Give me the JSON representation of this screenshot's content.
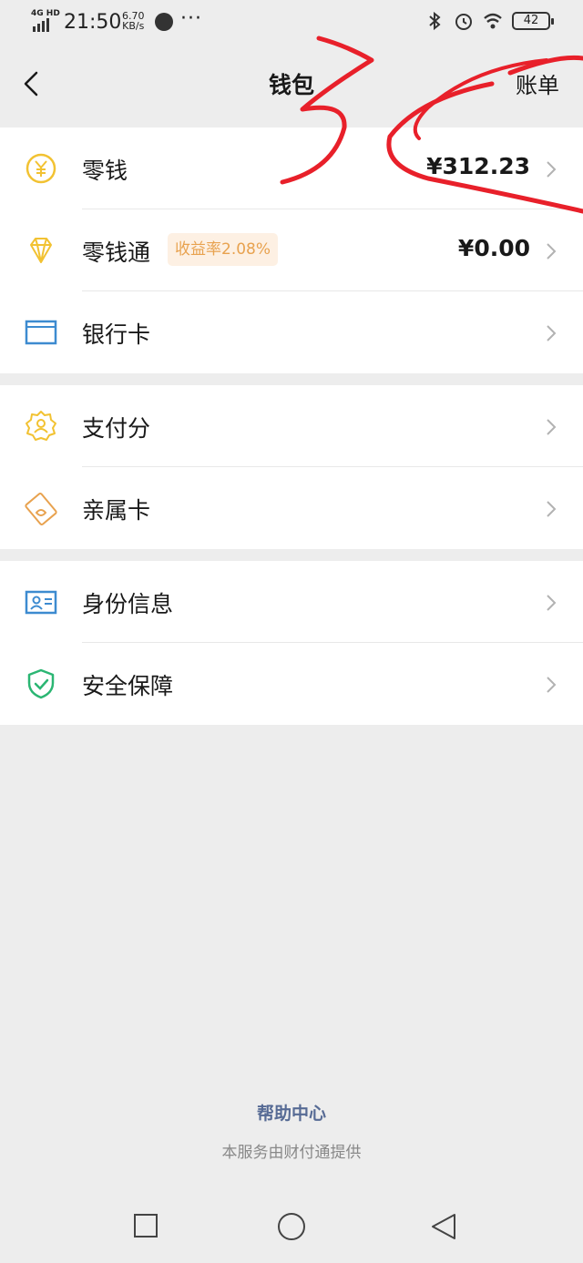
{
  "status_bar": {
    "network": "4G HD",
    "time": "21:50",
    "speed_value": "6.70",
    "speed_unit": "KB/s",
    "more": "···",
    "battery": "42"
  },
  "nav": {
    "title": "钱包",
    "right_link": "账单"
  },
  "groups": [
    {
      "items": [
        {
          "icon": "yuan-coin-icon",
          "label": "零钱",
          "value": "¥312.23"
        },
        {
          "icon": "diamond-icon",
          "label": "零钱通",
          "badge": "收益率2.08%",
          "value": "¥0.00"
        },
        {
          "icon": "bank-card-icon",
          "label": "银行卡"
        }
      ]
    },
    {
      "items": [
        {
          "icon": "pay-score-icon",
          "label": "支付分"
        },
        {
          "icon": "family-card-icon",
          "label": "亲属卡"
        }
      ]
    },
    {
      "items": [
        {
          "icon": "id-card-icon",
          "label": "身份信息"
        },
        {
          "icon": "shield-check-icon",
          "label": "安全保障"
        }
      ]
    }
  ],
  "footer": {
    "help": "帮助中心",
    "provider": "本服务由财付通提供"
  },
  "colors": {
    "background": "#ededed",
    "link": "#576b95",
    "badge_text": "#e8a24f",
    "badge_bg": "#fdf0e3",
    "icon_yellow": "#f2c232",
    "icon_blue": "#3d8bd0",
    "icon_green": "#2bb673",
    "icon_orange": "#e8a24f",
    "annotation_red": "#e8202a"
  }
}
